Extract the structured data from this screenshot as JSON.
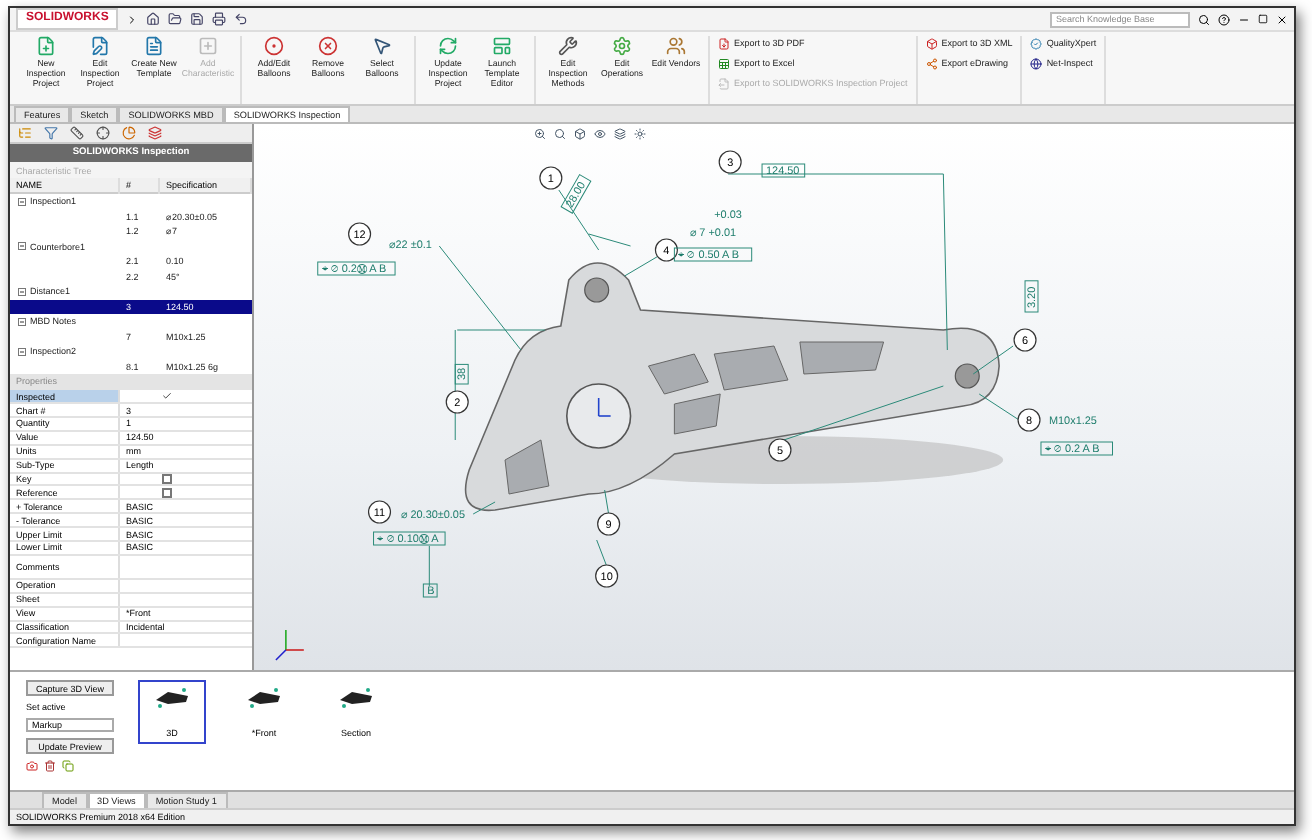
{
  "title_bar": {
    "logo": "SOLIDWORKS",
    "search": {
      "placeholder": "Search Knowledge Base"
    }
  },
  "ribbon": {
    "groups": [
      {
        "kind": "large",
        "buttons": [
          {
            "label": "New Inspection Project",
            "disabled": false
          },
          {
            "label": "Edit Inspection Project",
            "disabled": false
          },
          {
            "label": "Create New Template",
            "disabled": false
          },
          {
            "label": "Add Characteristic",
            "disabled": true
          }
        ]
      },
      {
        "kind": "large",
        "buttons": [
          {
            "label": "Add/Edit Balloons",
            "disabled": false
          },
          {
            "label": "Remove Balloons",
            "disabled": false
          },
          {
            "label": "Select Balloons",
            "disabled": false
          }
        ]
      },
      {
        "kind": "large",
        "buttons": [
          {
            "label": "Update Inspection Project",
            "disabled": false
          },
          {
            "label": "Launch Template Editor",
            "disabled": false
          }
        ]
      },
      {
        "kind": "large",
        "buttons": [
          {
            "label": "Edit Inspection Methods",
            "disabled": false
          },
          {
            "label": "Edit Operations",
            "disabled": false
          },
          {
            "label": "Edit Vendors",
            "disabled": false
          }
        ]
      },
      {
        "kind": "small",
        "buttons": [
          {
            "label": "Export to 3D PDF",
            "disabled": false
          },
          {
            "label": "Export to Excel",
            "disabled": false
          },
          {
            "label": "Export to SOLIDWORKS Inspection Project",
            "disabled": true
          }
        ]
      },
      {
        "kind": "small",
        "buttons": [
          {
            "label": "Export to 3D XML",
            "disabled": false
          },
          {
            "label": "Export eDrawing",
            "disabled": false
          }
        ]
      },
      {
        "kind": "small",
        "buttons": [
          {
            "label": "QualityXpert",
            "disabled": false
          },
          {
            "label": "Net-Inspect",
            "disabled": false
          }
        ]
      }
    ]
  },
  "command_tabs": [
    {
      "label": "Features",
      "selected": false
    },
    {
      "label": "Sketch",
      "selected": false
    },
    {
      "label": "SOLIDWORKS MBD",
      "selected": false
    },
    {
      "label": "SOLIDWORKS Inspection",
      "selected": true
    }
  ],
  "panel": {
    "title": "SOLIDWORKS Inspection",
    "tree_title": "Characteristic Tree",
    "columns": [
      "NAME",
      "#",
      "Specification"
    ],
    "items": [
      {
        "name": "Inspection1",
        "expanded": true,
        "selected": false,
        "children": [
          {
            "number": "1.1",
            "spec": "⌀20.30±0.05",
            "selected": false
          },
          {
            "number": "1.2",
            "spec": "⌀7",
            "selected": false
          }
        ]
      },
      {
        "name": "Counterbore1",
        "expanded": true,
        "selected": false,
        "children": [
          {
            "number": "2.1",
            "spec": "0.10",
            "selected": false
          },
          {
            "number": "2.2",
            "spec": "45°",
            "selected": false
          }
        ]
      },
      {
        "name": "Distance1",
        "expanded": true,
        "selected": false,
        "children": [
          {
            "number": "3",
            "spec": "124.50",
            "selected": true
          }
        ]
      },
      {
        "name": "MBD Notes",
        "expanded": true,
        "selected": false,
        "children": [
          {
            "number": "7",
            "spec": "M10x1.25",
            "selected": false
          }
        ]
      },
      {
        "name": "Inspection2",
        "expanded": true,
        "selected": false,
        "children": [
          {
            "number": "8.1",
            "spec": "M10x1.25 6g",
            "selected": false
          }
        ]
      }
    ]
  },
  "properties": {
    "title": "Properties",
    "rows": [
      {
        "label": "Inspected",
        "kind": "check",
        "checked": true,
        "selected": true
      },
      {
        "label": "Chart #",
        "kind": "text",
        "value": "3",
        "selected": false
      },
      {
        "label": "Quantity",
        "kind": "text",
        "value": "1",
        "selected": false
      },
      {
        "label": "Value",
        "kind": "text",
        "value": "124.50",
        "selected": false
      },
      {
        "label": "Units",
        "kind": "text",
        "value": "mm",
        "selected": false
      },
      {
        "label": "Sub-Type",
        "kind": "text",
        "value": "Length",
        "selected": false
      },
      {
        "label": "Key",
        "kind": "check",
        "checked": false,
        "selected": false
      },
      {
        "label": "Reference",
        "kind": "check",
        "checked": false,
        "selected": false
      },
      {
        "label": "+ Tolerance",
        "kind": "text",
        "value": "BASIC",
        "selected": false
      },
      {
        "label": "- Tolerance",
        "kind": "text",
        "value": "BASIC",
        "selected": false
      },
      {
        "label": "Upper Limit",
        "kind": "text",
        "value": "BASIC",
        "selected": false
      },
      {
        "label": "Lower Limit",
        "kind": "text",
        "value": "BASIC",
        "selected": false
      },
      {
        "label": "Comments",
        "kind": "tall",
        "value": "",
        "selected": false
      },
      {
        "label": "Operation",
        "kind": "text",
        "value": "",
        "selected": false
      },
      {
        "label": "Sheet",
        "kind": "text",
        "value": "",
        "selected": false
      },
      {
        "label": "View",
        "kind": "text",
        "value": "*Front",
        "selected": false
      },
      {
        "label": "Classification",
        "kind": "text",
        "value": "Incidental",
        "selected": false
      },
      {
        "label": "Configuration Name",
        "kind": "text",
        "value": "",
        "selected": false
      }
    ]
  },
  "viewport": {
    "balloons": [
      "1",
      "3",
      "12",
      "4",
      "2",
      "6",
      "8",
      "5",
      "11",
      "9",
      "10"
    ],
    "annotations": [
      {
        "text": "28.00",
        "framed": true
      },
      {
        "text": "124.50",
        "framed": true
      },
      {
        "text": "⌀22 ±0.1",
        "framed": false
      },
      {
        "text": "⌖ ⌀ 0.2Ⓜ A B",
        "framed": true
      },
      {
        "text": "+0.03",
        "framed": false
      },
      {
        "text": "⌀ 7 +0.01",
        "framed": false
      },
      {
        "text": "⌖ ⌀ 0.50 A B",
        "framed": true
      },
      {
        "text": "38",
        "framed": true
      },
      {
        "text": "3.20",
        "framed": true
      },
      {
        "text": "M10x1.25",
        "framed": false
      },
      {
        "text": "⌖ ⌀ 0.2 A B",
        "framed": true
      },
      {
        "text": "⌀ 20.30±0.05",
        "framed": false
      },
      {
        "text": "⌖ ⌀ 0.10Ⓜ A",
        "framed": true
      },
      {
        "text": "B",
        "framed": true
      }
    ]
  },
  "views_panel": {
    "capture": "Capture 3D View",
    "set_label": "Set active",
    "select_value": "Markup",
    "update": "Update Preview",
    "thumbnails": [
      {
        "label": "3D",
        "selected": true
      },
      {
        "label": "*Front",
        "selected": false
      },
      {
        "label": "Section",
        "selected": false
      }
    ]
  },
  "bottom_tabs": [
    {
      "label": "Model",
      "selected": false
    },
    {
      "label": "3D Views",
      "selected": true
    },
    {
      "label": "Motion Study 1",
      "selected": false
    }
  ],
  "status_bar": "SOLIDWORKS Premium 2018 x64 Edition"
}
